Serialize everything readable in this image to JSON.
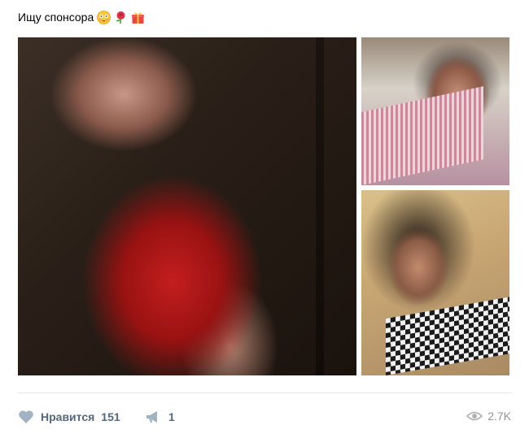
{
  "post": {
    "text": "Ищу спонсора",
    "emojis": [
      "flushed-face-emoji",
      "rose-emoji",
      "gift-emoji"
    ]
  },
  "photos": [
    {
      "name": "photo-main",
      "description_icon": "photo"
    },
    {
      "name": "photo-top-right",
      "description_icon": "photo"
    },
    {
      "name": "photo-bottom-right",
      "description_icon": "photo"
    }
  ],
  "actions": {
    "like_label": "Нравится",
    "like_count": "151",
    "share_count": "1",
    "views": "2.7K"
  },
  "icons": {
    "like": "heart-icon",
    "share": "megaphone-icon",
    "views": "eye-icon"
  },
  "colors": {
    "action_text": "#55677d",
    "views_text": "#939393",
    "divider": "#e7e8ec"
  }
}
